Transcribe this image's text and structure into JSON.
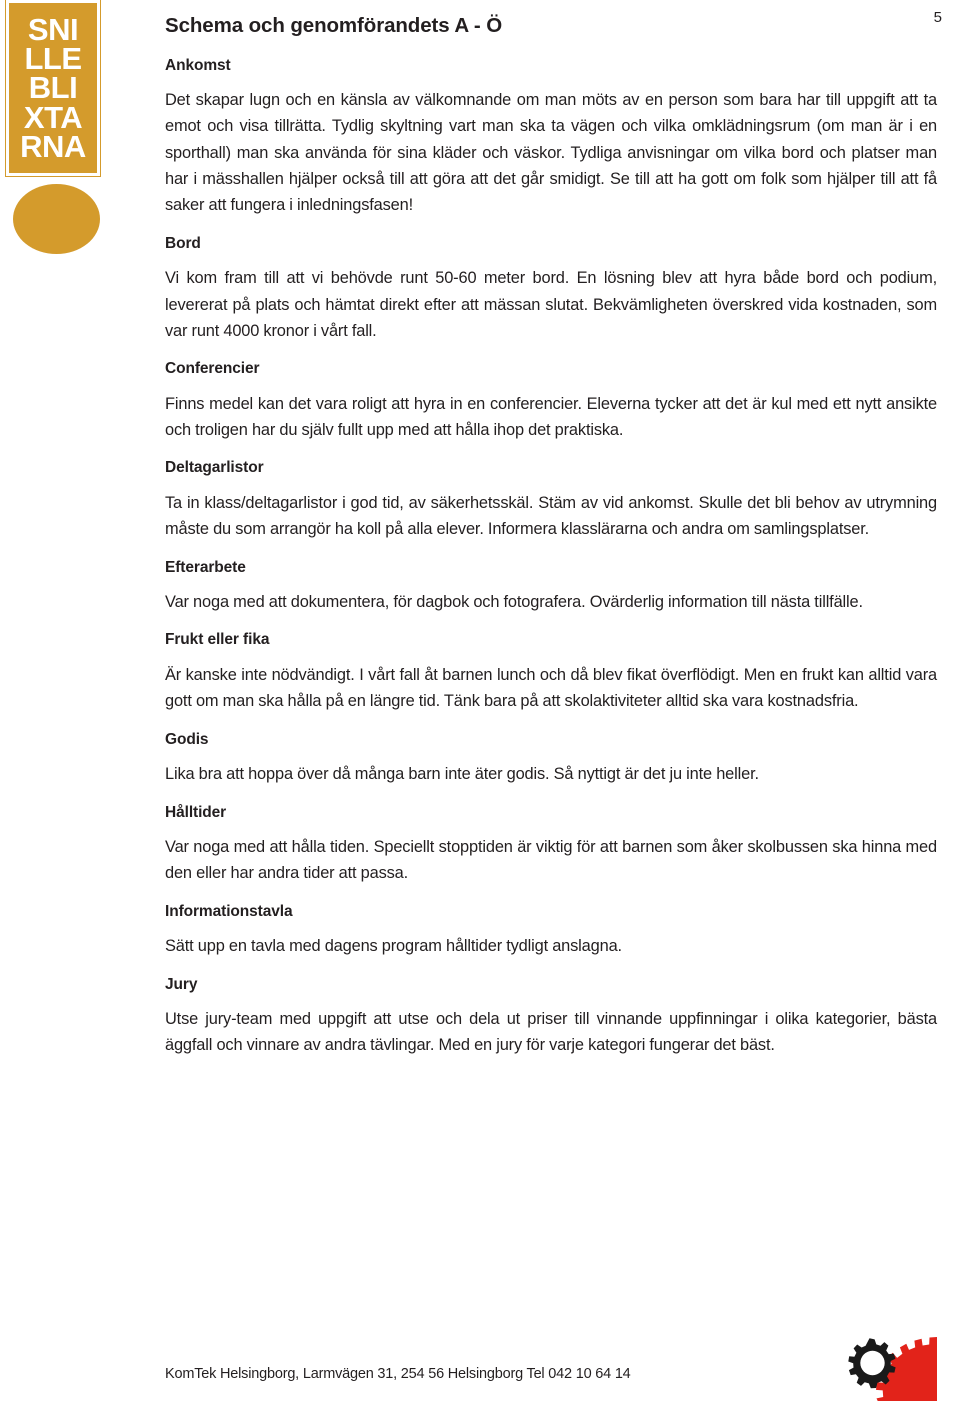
{
  "document": {
    "page_number": "5",
    "title": "Schema och genomförandets A - Ö",
    "language": "sv"
  },
  "brand": {
    "name": "SNILLEBLIXTARNA",
    "lines": [
      "SNI",
      "LLE",
      "BLI",
      "XTA",
      "RNA"
    ],
    "color": "#d49b2c",
    "text_color": "#ffffff"
  },
  "sections": [
    {
      "heading": "Ankomst",
      "body": "Det skapar lugn och en känsla av välkomnande om man möts av en person som bara har till uppgift att ta emot och visa tillrätta. Tydlig skyltning vart man ska ta vägen och vilka omklädningsrum (om man är i en sporthall) man ska använda för sina kläder och väskor. Tydliga anvisningar om vilka bord och platser man har i mässhallen hjälper också till att göra att det går smidigt. Se till att ha gott om folk som hjälper till att få saker att fungera i inledningsfasen!"
    },
    {
      "heading": "Bord",
      "body": "Vi kom fram till att vi behövde runt 50-60 meter bord. En lösning blev att hyra både bord och podium, levererat på plats och hämtat direkt efter att mässan slutat. Bekvämligheten överskred vida kostnaden, som var runt 4000 kronor i vårt fall."
    },
    {
      "heading": "Conferencier",
      "body": "Finns medel kan det vara roligt att hyra in en conferencier. Eleverna tycker att det är kul med ett nytt ansikte och troligen har du själv fullt upp med att hålla ihop det praktiska."
    },
    {
      "heading": "Deltagarlistor",
      "body": "Ta in klass/deltagarlistor i god tid, av säkerhetsskäl. Stäm av vid ankomst. Skulle det bli behov av utrymning måste du som arrangör ha koll på alla elever. Informera klasslärarna och andra om samlingsplatser."
    },
    {
      "heading": "Efterarbete",
      "body": "Var noga med att dokumentera, för dagbok och fotografera. Ovärderlig information till nästa tillfälle."
    },
    {
      "heading": "Frukt eller fika",
      "body": "Är kanske inte nödvändigt. I vårt fall åt barnen lunch och då blev fikat överflödigt. Men en frukt kan alltid vara gott om man ska hålla på en längre tid. Tänk bara på att skolaktiviteter alltid ska vara kostnadsfria."
    },
    {
      "heading": "Godis",
      "body": "Lika bra att hoppa över då många barn inte äter godis. Så nyttigt är det ju inte heller."
    },
    {
      "heading": "Hålltider",
      "body": "Var noga med att hålla tiden. Speciellt stopptiden är viktig för att barnen som åker skolbussen ska hinna med den eller har andra tider att passa."
    },
    {
      "heading": "Informationstavla",
      "body": "Sätt upp en tavla med dagens program hålltider tydligt anslagna."
    },
    {
      "heading": "Jury",
      "body": "Utse jury-team med uppgift att utse och dela ut priser till vinnande uppfinningar i olika kategorier, bästa äggfall och vinnare av andra tävlingar. Med en jury för varje kategori fungerar det bäst."
    }
  ],
  "footer": {
    "contact": "KomTek Helsingborg, Larmvägen 31, 254 56 Helsingborg  Tel 042 10 64 14",
    "logo_colors": {
      "gear_dark": "#1a1a1a",
      "gear_red": "#e2231a"
    }
  }
}
